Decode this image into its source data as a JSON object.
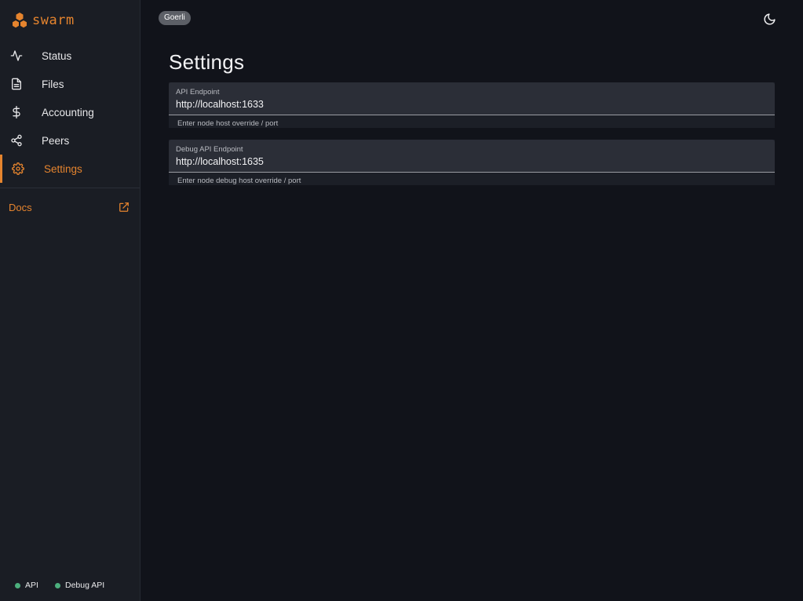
{
  "brand": {
    "name": "swarm",
    "accent_color": "#e5842e"
  },
  "sidebar": {
    "items": [
      {
        "label": "Status",
        "icon": "activity-icon",
        "active": false
      },
      {
        "label": "Files",
        "icon": "file-text-icon",
        "active": false
      },
      {
        "label": "Accounting",
        "icon": "dollar-icon",
        "active": false
      },
      {
        "label": "Peers",
        "icon": "share-icon",
        "active": false
      },
      {
        "label": "Settings",
        "icon": "gear-icon",
        "active": true
      }
    ],
    "docs": {
      "label": "Docs",
      "icon": "external-link-icon"
    },
    "status": [
      {
        "label": "API",
        "color": "#4caf7d"
      },
      {
        "label": "Debug API",
        "color": "#4caf7d"
      }
    ]
  },
  "header": {
    "network_chip": "Goerli",
    "theme_toggle_icon": "moon-icon"
  },
  "main": {
    "title": "Settings",
    "fields": [
      {
        "label": "API Endpoint",
        "value": "http://localhost:1633",
        "helper": "Enter node host override / port"
      },
      {
        "label": "Debug API Endpoint",
        "value": "http://localhost:1635",
        "helper": "Enter node debug host override / port"
      }
    ]
  }
}
